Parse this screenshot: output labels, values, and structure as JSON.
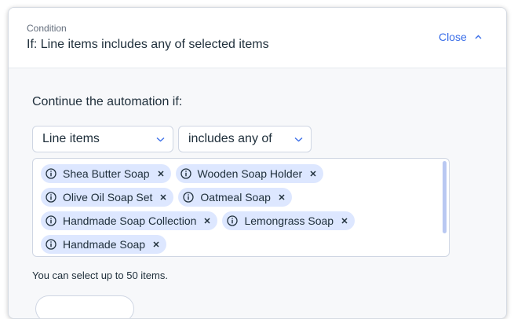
{
  "header": {
    "eyebrow": "Condition",
    "title": "If: Line items includes any of selected items",
    "close_label": "Close"
  },
  "body": {
    "section_label": "Continue the automation if:",
    "field_select": {
      "value": "Line items"
    },
    "operator_select": {
      "value": "includes any of"
    },
    "selected_items": [
      [
        "Shea Butter Soap",
        "Wooden Soap Holder"
      ],
      [
        "Olive Oil Soap Set",
        "Oatmeal Soap"
      ],
      [
        "Handmade Soap Collection",
        "Lemongrass Soap"
      ],
      [
        "Handmade Soap"
      ]
    ],
    "hint": "You can select up to 50 items."
  },
  "colors": {
    "accent": "#3a6ee8",
    "tag_background": "#dde7ff",
    "text": "#20303c",
    "panel_background": "#f7f8fa"
  },
  "icons": {
    "collapse": "chevron-up-icon",
    "dropdown": "chevron-down-icon",
    "tag_info": "info-icon",
    "tag_remove": "close-icon"
  }
}
